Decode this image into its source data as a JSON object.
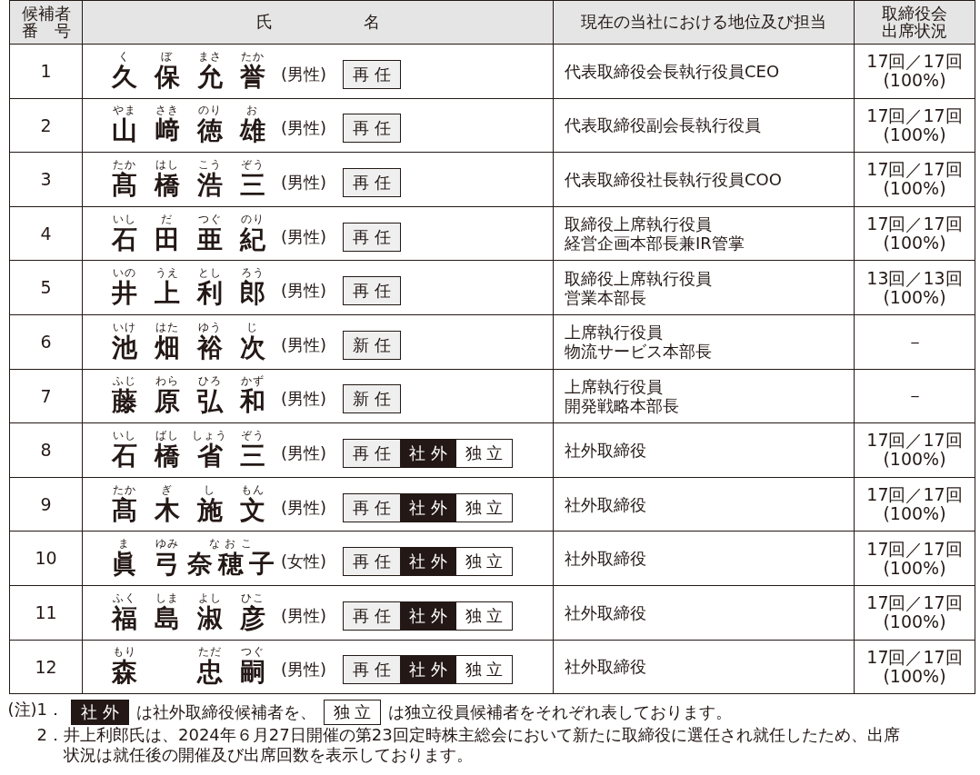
{
  "table": {
    "columns": [
      [
        "候補者",
        "番　号"
      ],
      [
        "氏"
      ],
      [
        "名"
      ],
      [
        "現在の当社における地位及び担当"
      ],
      [
        "取締役会",
        "出席状況"
      ]
    ],
    "rows": [
      {
        "number": "1",
        "name": [
          {
            "kind": "single",
            "kanji": "久",
            "ruby": "く"
          },
          {
            "kind": "single",
            "kanji": "保",
            "ruby": "ぼ"
          },
          {
            "kind": "single",
            "kanji": "允",
            "ruby": "まさ"
          },
          {
            "kind": "single",
            "kanji": "誉",
            "ruby": "たか"
          }
        ],
        "gender": "(男性)",
        "tags": [
          {
            "label": "再 任",
            "kind": "plain"
          }
        ],
        "position": [
          "代表取締役会長執行役員CEO"
        ],
        "attendance": [
          "17回／17回",
          "(100%)"
        ]
      },
      {
        "number": "2",
        "name": [
          {
            "kind": "single",
            "kanji": "山",
            "ruby": "やま"
          },
          {
            "kind": "single",
            "kanji": "﨑",
            "ruby": "さき"
          },
          {
            "kind": "single",
            "kanji": "徳",
            "ruby": "のり"
          },
          {
            "kind": "single",
            "kanji": "雄",
            "ruby": "お"
          }
        ],
        "gender": "(男性)",
        "tags": [
          {
            "label": "再 任",
            "kind": "plain"
          }
        ],
        "position": [
          "代表取締役副会長執行役員"
        ],
        "attendance": [
          "17回／17回",
          "(100%)"
        ]
      },
      {
        "number": "3",
        "name": [
          {
            "kind": "single",
            "kanji": "髙",
            "ruby": "たか"
          },
          {
            "kind": "single",
            "kanji": "橋",
            "ruby": "はし"
          },
          {
            "kind": "single",
            "kanji": "浩",
            "ruby": "こう"
          },
          {
            "kind": "single",
            "kanji": "三",
            "ruby": "ぞう"
          }
        ],
        "gender": "(男性)",
        "tags": [
          {
            "label": "再 任",
            "kind": "plain"
          }
        ],
        "position": [
          "代表取締役社長執行役員COO"
        ],
        "attendance": [
          "17回／17回",
          "(100%)"
        ]
      },
      {
        "number": "4",
        "name": [
          {
            "kind": "single",
            "kanji": "石",
            "ruby": "いし"
          },
          {
            "kind": "single",
            "kanji": "田",
            "ruby": "だ"
          },
          {
            "kind": "single",
            "kanji": "亜",
            "ruby": "つぐ"
          },
          {
            "kind": "single",
            "kanji": "紀",
            "ruby": "のり"
          }
        ],
        "gender": "(男性)",
        "tags": [
          {
            "label": "再 任",
            "kind": "plain"
          }
        ],
        "position": [
          "取締役上席執行役員",
          "経営企画本部長兼IR管掌"
        ],
        "attendance": [
          "17回／17回",
          "(100%)"
        ]
      },
      {
        "number": "5",
        "name": [
          {
            "kind": "single",
            "kanji": "井",
            "ruby": "いの"
          },
          {
            "kind": "single",
            "kanji": "上",
            "ruby": "うえ"
          },
          {
            "kind": "single",
            "kanji": "利",
            "ruby": "とし"
          },
          {
            "kind": "single",
            "kanji": "郎",
            "ruby": "ろう"
          }
        ],
        "gender": "(男性)",
        "tags": [
          {
            "label": "再 任",
            "kind": "plain"
          }
        ],
        "position": [
          "取締役上席執行役員",
          "営業本部長"
        ],
        "attendance": [
          "13回／13回",
          "(100%)"
        ]
      },
      {
        "number": "6",
        "name": [
          {
            "kind": "single",
            "kanji": "池",
            "ruby": "いけ"
          },
          {
            "kind": "single",
            "kanji": "畑",
            "ruby": "はた"
          },
          {
            "kind": "single",
            "kanji": "裕",
            "ruby": "ゆう"
          },
          {
            "kind": "single",
            "kanji": "次",
            "ruby": "じ"
          }
        ],
        "gender": "(男性)",
        "tags": [
          {
            "label": "新 任",
            "kind": "plain"
          }
        ],
        "position": [
          "上席執行役員",
          "物流サービス本部長"
        ],
        "attendance": [
          "－"
        ]
      },
      {
        "number": "7",
        "name": [
          {
            "kind": "single",
            "kanji": "藤",
            "ruby": "ふじ"
          },
          {
            "kind": "single",
            "kanji": "原",
            "ruby": "わら"
          },
          {
            "kind": "single",
            "kanji": "弘",
            "ruby": "ひろ"
          },
          {
            "kind": "single",
            "kanji": "和",
            "ruby": "かず"
          }
        ],
        "gender": "(男性)",
        "tags": [
          {
            "label": "新 任",
            "kind": "plain"
          }
        ],
        "position": [
          "上席執行役員",
          "開発戦略本部長"
        ],
        "attendance": [
          "－"
        ]
      },
      {
        "number": "8",
        "name": [
          {
            "kind": "single",
            "kanji": "石",
            "ruby": "いし"
          },
          {
            "kind": "single",
            "kanji": "橋",
            "ruby": "ばし"
          },
          {
            "kind": "single",
            "kanji": "省",
            "ruby": "しょう"
          },
          {
            "kind": "single",
            "kanji": "三",
            "ruby": "ぞう"
          }
        ],
        "gender": "(男性)",
        "tags": [
          {
            "label": "再 任",
            "kind": "plain"
          },
          {
            "label": "社 外",
            "kind": "inverse"
          },
          {
            "label": "独 立",
            "kind": "plain"
          }
        ],
        "position": [
          "社外取締役"
        ],
        "attendance": [
          "17回／17回",
          "(100%)"
        ]
      },
      {
        "number": "9",
        "name": [
          {
            "kind": "single",
            "kanji": "髙",
            "ruby": "たか"
          },
          {
            "kind": "single",
            "kanji": "木",
            "ruby": "ぎ"
          },
          {
            "kind": "single",
            "kanji": "施",
            "ruby": "し"
          },
          {
            "kind": "single",
            "kanji": "文",
            "ruby": "もん"
          }
        ],
        "gender": "(男性)",
        "tags": [
          {
            "label": "再 任",
            "kind": "plain"
          },
          {
            "label": "社 外",
            "kind": "inverse"
          },
          {
            "label": "独 立",
            "kind": "plain"
          }
        ],
        "position": [
          "社外取締役"
        ],
        "attendance": [
          "17回／17回",
          "(100%)"
        ]
      },
      {
        "number": "10",
        "name": [
          {
            "kind": "single",
            "kanji": "眞",
            "ruby": "ま"
          },
          {
            "kind": "single",
            "kanji": "弓",
            "ruby": "ゆみ"
          },
          {
            "kind": "wide",
            "kanji": "奈穂子",
            "ruby": "な お こ"
          }
        ],
        "gender": "(女性)",
        "tags": [
          {
            "label": "再 任",
            "kind": "plain"
          },
          {
            "label": "社 外",
            "kind": "inverse"
          },
          {
            "label": "独 立",
            "kind": "plain"
          }
        ],
        "position": [
          "社外取締役"
        ],
        "attendance": [
          "17回／17回",
          "(100%)"
        ]
      },
      {
        "number": "11",
        "name": [
          {
            "kind": "single",
            "kanji": "福",
            "ruby": "ふく"
          },
          {
            "kind": "single",
            "kanji": "島",
            "ruby": "しま"
          },
          {
            "kind": "single",
            "kanji": "淑",
            "ruby": "よし"
          },
          {
            "kind": "single",
            "kanji": "彦",
            "ruby": "ひこ"
          }
        ],
        "gender": "(男性)",
        "tags": [
          {
            "label": "再 任",
            "kind": "plain"
          },
          {
            "label": "社 外",
            "kind": "inverse"
          },
          {
            "label": "独 立",
            "kind": "plain"
          }
        ],
        "position": [
          "社外取締役"
        ],
        "attendance": [
          "17回／17回",
          "(100%)"
        ]
      },
      {
        "number": "12",
        "name": [
          {
            "kind": "single",
            "kanji": "森",
            "ruby": "もり"
          },
          {
            "kind": "after-gap",
            "kanji": "忠",
            "ruby": "ただ"
          },
          {
            "kind": "single",
            "kanji": "嗣",
            "ruby": "つぐ"
          }
        ],
        "gender": "(男性)",
        "tags": [
          {
            "label": "再 任",
            "kind": "plain"
          },
          {
            "label": "社 外",
            "kind": "inverse"
          },
          {
            "label": "独 立",
            "kind": "plain"
          }
        ],
        "position": [
          "社外取締役"
        ],
        "attendance": [
          "17回／17回",
          "(100%)"
        ]
      }
    ]
  },
  "notes": [
    {
      "prefix": "(注)",
      "number": "1．",
      "segments": [
        {
          "kind": "inverse",
          "text": "社 外"
        },
        {
          "kind": "text",
          "text": "は社外取締役候補者を、"
        },
        {
          "kind": "plain",
          "text": "独 立"
        },
        {
          "kind": "text",
          "text": "は独立役員候補者をそれぞれ表しております。"
        }
      ]
    },
    {
      "number": "2．",
      "segments": [
        {
          "kind": "text",
          "text": "井上利郎氏は、2024年６月27日開催の第23回定時株主総会において新たに取締役に選任され就任したため、出席状況は就任後の開催及び出席回数を表示しております。"
        }
      ]
    }
  ]
}
